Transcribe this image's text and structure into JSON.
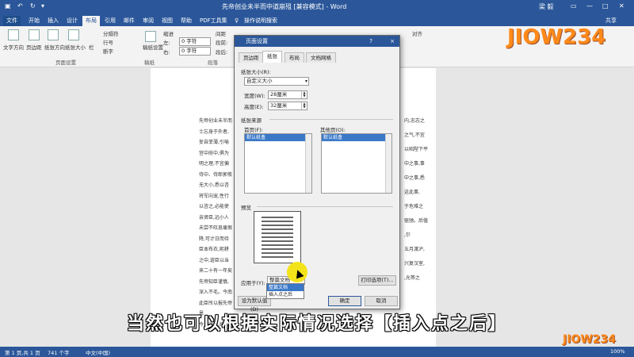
{
  "window": {
    "title": "先帝创业未半而中道崩殂 [兼容模式] - Word",
    "user": "梁 毅",
    "share": "共享",
    "tell_me": "操作说明搜索"
  },
  "tabs": [
    "文件",
    "开始",
    "插入",
    "设计",
    "布局",
    "引用",
    "邮件",
    "审阅",
    "视图",
    "帮助",
    "PDF工具集"
  ],
  "ribbon": {
    "text_direction": "文字方向",
    "margins": "页边距",
    "orientation": "纸张方向",
    "size": "纸张大小",
    "columns": "栏",
    "breaks": "分隔符",
    "line_numbers": "行号",
    "hyphenation": "断字",
    "page_setup_group": "页面设置",
    "draft_paper": "稿纸设置",
    "draft_group": "稿纸",
    "indent_label": "缩进",
    "spacing_label": "间距",
    "left": "左:",
    "right": "右:",
    "left_val": "0 字符",
    "right_val": "0 字符",
    "before": "段前:",
    "after": "段后:",
    "paragraph_group": "段落",
    "align": "对齐"
  },
  "dialog": {
    "title": "页面设置",
    "help": "?",
    "close": "×",
    "tabs": [
      "页边距",
      "纸张",
      "布局",
      "文档网格"
    ],
    "paper_size_label": "纸张大小(R):",
    "paper_size_value": "自定义大小",
    "width_label": "宽度(W):",
    "width_value": "28厘米",
    "height_label": "高度(E):",
    "height_value": "32厘米",
    "paper_source": "纸张来源",
    "first_page_label": "首页(F):",
    "first_page_item": "默认纸盒",
    "other_pages_label": "其他页(O):",
    "other_pages_item": "默认纸盒",
    "preview_label": "预览",
    "apply_to_label": "应用于(Y):",
    "apply_to_value": "整篇文档",
    "apply_options": [
      "整篇文档",
      "插入点之后"
    ],
    "print_options": "打印选项(T)...",
    "set_default": "设为默认值(D)",
    "ok": "确定",
    "cancel": "取消"
  },
  "document": {
    "left_lines": [
      "先帝创业未半而",
      "士忘身于外者,",
      "妄自菲薄,引喻",
      "宫中府中,俱为",
      "明之理,不宜偏",
      "侍中、侍郎郭攸",
      "无大小,悉以咨",
      "将军向宠,性行",
      "以咨之,必能使",
      "亲贤臣,远小人",
      "未尝不叹息痛恨",
      "降,可计日而待",
      "臣本布衣,躬耕",
      "之中,谘臣以当",
      "来二十有一年矣",
      "先帝知臣谨慎,",
      "深入不毛。今南",
      "此臣所以报先帝",
      "恩",
      "今当远离,临表"
    ],
    "right_lines": [
      "内,忠志之",
      "之气,不宜",
      "以昭陛下平",
      "中之事,事",
      "中之事,悉",
      "这此事,",
      "于危难之",
      "驱驰。后值",
      ",尔",
      "五月渡泸,",
      "兴复汉室,",
      ",允等之",
      "",
      ""
    ]
  },
  "status": {
    "page": "第 1 页,共 1 页",
    "words": "741 个字",
    "lang": "中文(中国)",
    "zoom": "100%"
  },
  "subtitle": "当然也可以根据实际情况选择【插入点之后】",
  "watermark": "JIOW234"
}
